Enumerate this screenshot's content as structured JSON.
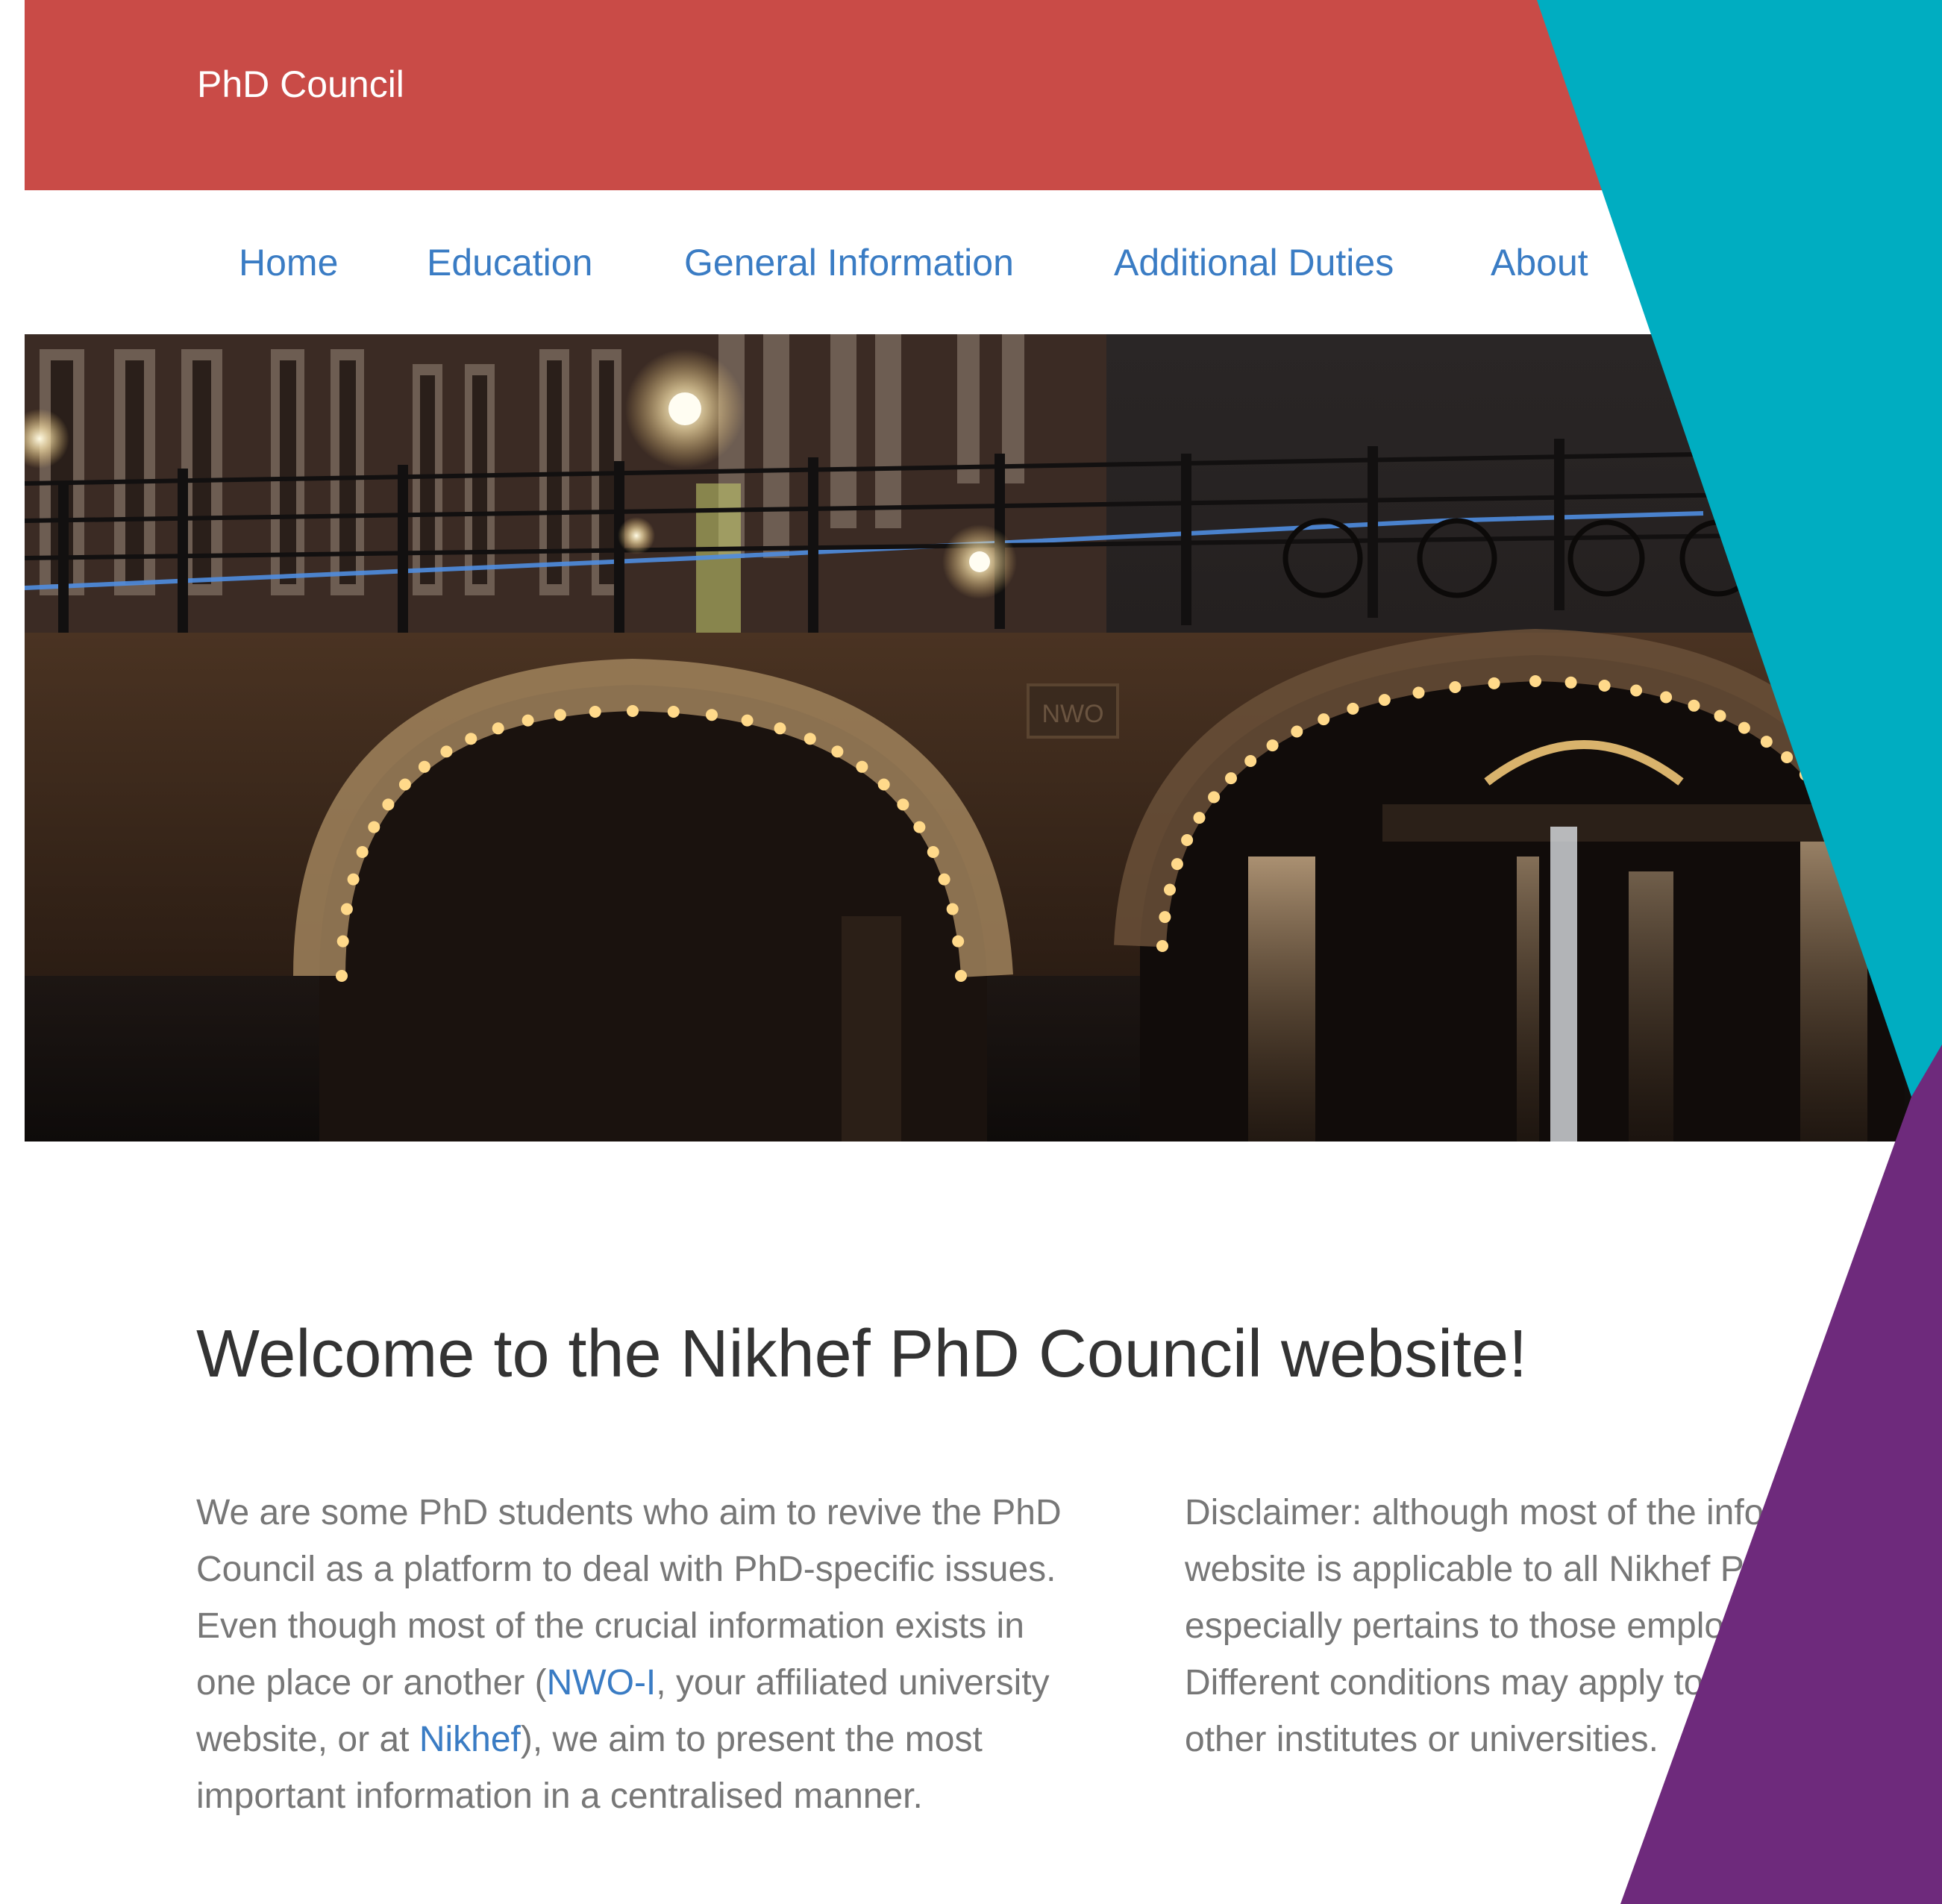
{
  "header": {
    "brand": "PhD Council"
  },
  "nav": {
    "items": [
      {
        "label": "Home"
      },
      {
        "label": "Education"
      },
      {
        "label": "General Information"
      },
      {
        "label": "Additional Duties"
      },
      {
        "label": "About"
      }
    ]
  },
  "hero": {
    "sign_text": "NWO"
  },
  "main": {
    "title": "Welcome to the Nikhef PhD Council website!",
    "intro": {
      "part1": "We are some PhD students who aim to revive the PhD Council as a platform to deal with PhD-specific issues. Even though most of the crucial information exists in one place or another (",
      "link1": "NWO-I",
      "part2": ", your affiliated university website, or at ",
      "link2": "Nikhef",
      "part3": "), we aim to present the most important information in a centralised manner."
    },
    "disclaimer": "Disclaimer: although most of the information on this website is applicable to all Nikhef PhD students, it especially pertains to those employed by NWO-I. Different conditions may apply to students employed by other institutes or universities."
  },
  "colors": {
    "header_bg": "#c94b47",
    "link": "#3a7cc4",
    "decor_teal": "#00adc1",
    "decor_purple": "#6e2a7c"
  }
}
